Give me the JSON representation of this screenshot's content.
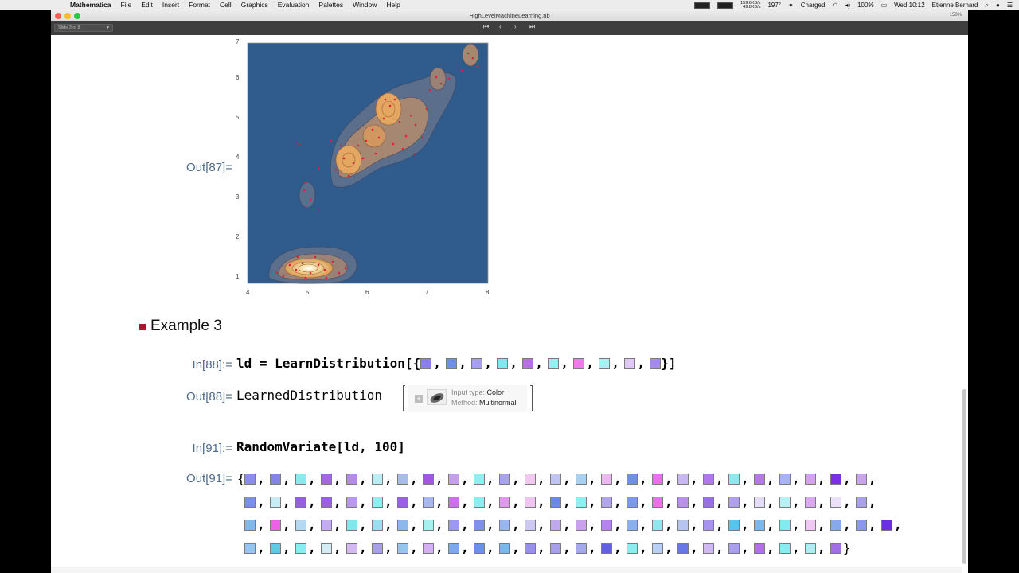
{
  "menubar": {
    "app": "Mathematica",
    "items": [
      "File",
      "Edit",
      "Insert",
      "Format",
      "Cell",
      "Graphics",
      "Evaluation",
      "Palettes",
      "Window",
      "Help"
    ],
    "net_up": "159.6KB/s",
    "net_down": "49.8KB/s",
    "temp": "197°",
    "battery_status": "Charged",
    "battery_pct": "100%",
    "clock": "Wed 10:12",
    "user": "Etienne Bernard"
  },
  "window": {
    "title": "HighLevelMachineLearning.nb",
    "zoom": "150%",
    "slide": "Slide 3 of 8"
  },
  "plot": {
    "x_ticks": [
      "4",
      "5",
      "6",
      "7",
      "8"
    ],
    "y_ticks": [
      "1",
      "2",
      "3",
      "4",
      "5",
      "6",
      "7"
    ],
    "bg_color": "#2f5b8d",
    "contour_color": "#e8a860",
    "point_color": "#e0203a"
  },
  "cells": {
    "out87_label": "Out[87]=",
    "section_title": "Example 3",
    "in88_label": "In[88]:=",
    "in88_code_prefix": "ld = LearnDistribution[{",
    "in88_code_suffix": "}]",
    "in88_swatches": [
      "#8a7ef0",
      "#6f8fe8",
      "#a69ef2",
      "#7fe9ef",
      "#b56de8",
      "#92f0f0",
      "#ef7ae8",
      "#a4f2f2",
      "#e0c8f4",
      "#a48af0"
    ],
    "out88_label": "Out[88]=",
    "out88_head": "LearnedDistribution",
    "summary": {
      "input_type_label": "Input type:",
      "input_type_value": "Color",
      "method_label": "Method:",
      "method_value": "Multinormal"
    },
    "in91_label": "In[91]:=",
    "in91_code": "RandomVariate[ld, 100]",
    "out91_label": "Out[91]=",
    "out91_open": "{",
    "out91_close": "}",
    "out91_rows": [
      [
        "#8c8cec",
        "#8484e4",
        "#8ce8ec",
        "#a468e4",
        "#b48ce8",
        "#bcecf4",
        "#a8bcec",
        "#a058e0",
        "#c4a0ec",
        "#8cf0f0",
        "#a8a4ec",
        "#f0c8f0",
        "#c0c4f0",
        "#a8d0f0",
        "#ecb8f0",
        "#7090e8",
        "#e870e8",
        "#c8b8f0",
        "#b078e8",
        "#8ce8ec",
        "#b478e8",
        "#a8b4f0",
        "#d4a0f0",
        "#7a30e0",
        "#c8a4ec"
      ],
      [
        "#7a90e8",
        "#c8ecf4",
        "#9460e0",
        "#9a60e0",
        "#b898ec",
        "#8cf0f0",
        "#9a60e0",
        "#a8b8ec",
        "#cc70e8",
        "#8cecf0",
        "#e098ec",
        "#f0c4f0",
        "#6a88e8",
        "#8cf0f0",
        "#b0a4ec",
        "#7c98e8",
        "#e870e8",
        "#b890ec",
        "#9870e4",
        "#b0a0ec",
        "#e4dcf4",
        "#b8f0f4",
        "#dca8f0",
        "#ece0f8",
        "#a8a0ec"
      ],
      [
        "#80b8ec",
        "#ee60e8",
        "#b4d8f0",
        "#c4acf0",
        "#80e8ec",
        "#98e0f0",
        "#8cb8ec",
        "#a8f0f0",
        "#9c98ec",
        "#8090e8",
        "#98b8ec",
        "#ccc8f4",
        "#c0a8ec",
        "#c8a0ec",
        "#b484e8",
        "#8cb0ec",
        "#8ce8ec",
        "#b8c4f0",
        "#a894ec",
        "#58c4e8",
        "#7cb8ec",
        "#80ecf0",
        "#f0c8f4",
        "#88a8ec",
        "#8c98ec",
        "#6a30e0"
      ],
      [
        "#98c4f0",
        "#60c8ec",
        "#88ecf0",
        "#d4ecf4",
        "#d4b8f0",
        "#a8a0ec",
        "#98c4f0",
        "#d4b0f0",
        "#7ca8ec",
        "#6c90e8",
        "#7cb8ec",
        "#9890ec",
        "#a8a0ec",
        "#a4a8ec",
        "#6060e0",
        "#8cecf0",
        "#b8d0f4",
        "#6878e4",
        "#d0b8f0",
        "#a8a0ec",
        "#b070e8",
        "#88ecf0",
        "#a8f0f4",
        "#a070e4"
      ]
    ]
  }
}
